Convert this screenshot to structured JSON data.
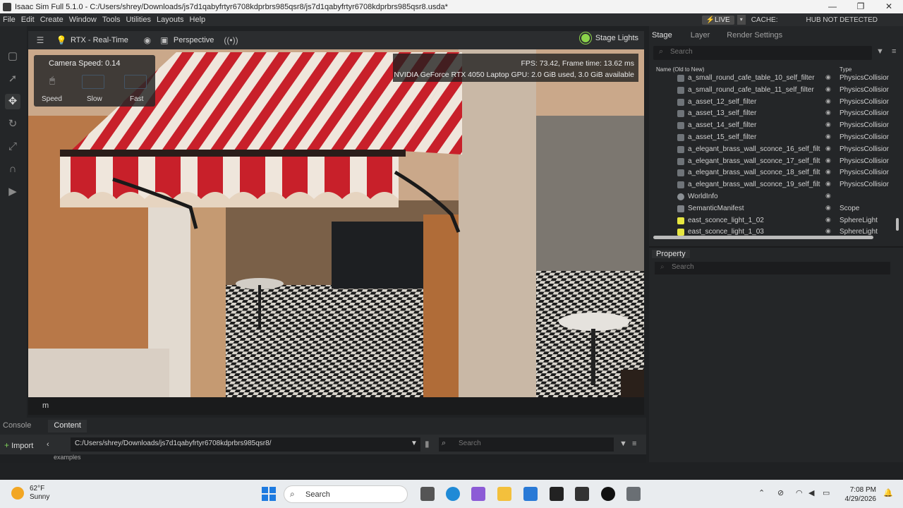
{
  "window": {
    "title": "Isaac Sim Full 5.1.0 - C:/Users/shrey/Downloads/js7d1qabyfrtyr6708kdprbrs985qsr8/js7d1qabyfrtyr6708kdprbrs985qsr8.usda*",
    "minimize": "—",
    "maximize": "❐",
    "close": "✕"
  },
  "menu": {
    "items": [
      "File",
      "Edit",
      "Create",
      "Window",
      "Tools",
      "Utilities",
      "Layouts",
      "Help"
    ],
    "live": "LIVE",
    "cache": "CACHE:",
    "hub": "HUB NOT DETECTED"
  },
  "viewport": {
    "render_mode": "RTX - Real-Time",
    "camera": "Perspective",
    "stage_lights": "Stage Lights",
    "camera_speed": "Camera Speed: 0.14",
    "speed_buttons": [
      "Speed",
      "Slow",
      "Fast"
    ],
    "fps": "FPS: 73.42, Frame time: 13.62 ms",
    "gpu": "NVIDIA GeForce RTX 4050 Laptop GPU: 2.0 GiB used, 3.0 GiB available",
    "footer": "m"
  },
  "stage": {
    "tabs": [
      "Stage",
      "Layer",
      "Render Settings"
    ],
    "search_placeholder": "Search",
    "col_name": "Name (Old to New)",
    "col_type": "Type",
    "rows": [
      {
        "name": "a_small_round_cafe_table_10_self_filter",
        "type": "PhysicsCollision",
        "icon": "filter"
      },
      {
        "name": "a_small_round_cafe_table_11_self_filter",
        "type": "PhysicsCollision",
        "icon": "filter"
      },
      {
        "name": "a_asset_12_self_filter",
        "type": "PhysicsCollision",
        "icon": "filter"
      },
      {
        "name": "a_asset_13_self_filter",
        "type": "PhysicsCollision",
        "icon": "filter"
      },
      {
        "name": "a_asset_14_self_filter",
        "type": "PhysicsCollision",
        "icon": "filter"
      },
      {
        "name": "a_asset_15_self_filter",
        "type": "PhysicsCollision",
        "icon": "filter"
      },
      {
        "name": "a_elegant_brass_wall_sconce_16_self_filt",
        "type": "PhysicsCollision",
        "icon": "filter"
      },
      {
        "name": "a_elegant_brass_wall_sconce_17_self_filt",
        "type": "PhysicsCollision",
        "icon": "filter"
      },
      {
        "name": "a_elegant_brass_wall_sconce_18_self_filt",
        "type": "PhysicsCollision",
        "icon": "filter"
      },
      {
        "name": "a_elegant_brass_wall_sconce_19_self_filt",
        "type": "PhysicsCollision",
        "icon": "filter"
      },
      {
        "name": "WorldInfo",
        "type": "",
        "icon": "world"
      },
      {
        "name": "SemanticManifest",
        "type": "Scope",
        "icon": "folder"
      },
      {
        "name": "east_sconce_light_1_02",
        "type": "SphereLight",
        "icon": "light"
      },
      {
        "name": "east_sconce_light_1_03",
        "type": "SphereLight",
        "icon": "light"
      }
    ]
  },
  "property": {
    "tab": "Property",
    "search_placeholder": "Search"
  },
  "content": {
    "tabs": [
      "Console",
      "Content"
    ],
    "import": "Import",
    "path": "C:/Users/shrey/Downloads/js7d1qabyfrtyr6708kdprbrs985qsr8/",
    "search_placeholder": "Search",
    "examples": "examples"
  },
  "taskbar": {
    "temp": "62°F",
    "weather": "Sunny",
    "search": "Search",
    "time": "7:08 PM",
    "date": "4/29/2026"
  },
  "colors": {
    "accent": "#8bd34a",
    "awning_red": "#c8202a",
    "panel": "#242628"
  }
}
